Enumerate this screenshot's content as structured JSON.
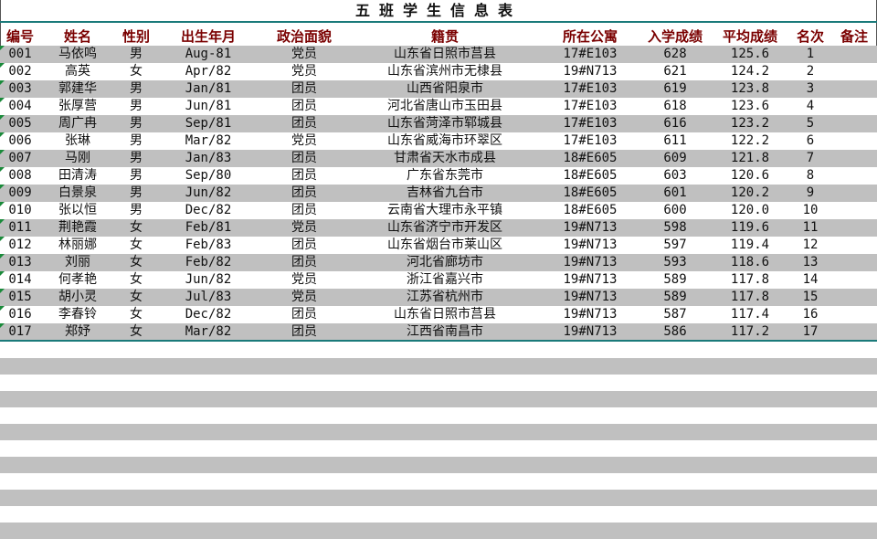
{
  "title": "五班学生信息表",
  "headers": [
    "编号",
    "姓名",
    "性别",
    "出生年月",
    "政治面貌",
    "籍贯",
    "所在公寓",
    "入学成绩",
    "平均成绩",
    "名次",
    "备注"
  ],
  "rows": [
    {
      "id": "001",
      "name": "马依鸣",
      "gender": "男",
      "birth": "Aug-81",
      "political": "党员",
      "native": "山东省日照市莒县",
      "dorm": "17#E103",
      "entry": "628",
      "avg": "125.6",
      "rank": "1",
      "note": ""
    },
    {
      "id": "002",
      "name": "高英",
      "gender": "女",
      "birth": "Apr/82",
      "political": "党员",
      "native": "山东省滨州市无棣县",
      "dorm": "19#N713",
      "entry": "621",
      "avg": "124.2",
      "rank": "2",
      "note": ""
    },
    {
      "id": "003",
      "name": "郭建华",
      "gender": "男",
      "birth": "Jan/81",
      "political": "团员",
      "native": "山西省阳泉市",
      "dorm": "17#E103",
      "entry": "619",
      "avg": "123.8",
      "rank": "3",
      "note": ""
    },
    {
      "id": "004",
      "name": "张厚营",
      "gender": "男",
      "birth": "Jun/81",
      "political": "团员",
      "native": "河北省唐山市玉田县",
      "dorm": "17#E103",
      "entry": "618",
      "avg": "123.6",
      "rank": "4",
      "note": ""
    },
    {
      "id": "005",
      "name": "周广冉",
      "gender": "男",
      "birth": "Sep/81",
      "political": "团员",
      "native": "山东省菏泽市郓城县",
      "dorm": "17#E103",
      "entry": "616",
      "avg": "123.2",
      "rank": "5",
      "note": ""
    },
    {
      "id": "006",
      "name": "张琳",
      "gender": "男",
      "birth": "Mar/82",
      "political": "党员",
      "native": "山东省威海市环翠区",
      "dorm": "17#E103",
      "entry": "611",
      "avg": "122.2",
      "rank": "6",
      "note": ""
    },
    {
      "id": "007",
      "name": "马刚",
      "gender": "男",
      "birth": "Jan/83",
      "political": "团员",
      "native": "甘肃省天水市成县",
      "dorm": "18#E605",
      "entry": "609",
      "avg": "121.8",
      "rank": "7",
      "note": ""
    },
    {
      "id": "008",
      "name": "田清涛",
      "gender": "男",
      "birth": "Sep/80",
      "political": "团员",
      "native": "广东省东莞市",
      "dorm": "18#E605",
      "entry": "603",
      "avg": "120.6",
      "rank": "8",
      "note": ""
    },
    {
      "id": "009",
      "name": "白景泉",
      "gender": "男",
      "birth": "Jun/82",
      "political": "团员",
      "native": "吉林省九台市",
      "dorm": "18#E605",
      "entry": "601",
      "avg": "120.2",
      "rank": "9",
      "note": ""
    },
    {
      "id": "010",
      "name": "张以恒",
      "gender": "男",
      "birth": "Dec/82",
      "political": "团员",
      "native": "云南省大理市永平镇",
      "dorm": "18#E605",
      "entry": "600",
      "avg": "120.0",
      "rank": "10",
      "note": ""
    },
    {
      "id": "011",
      "name": "荆艳霞",
      "gender": "女",
      "birth": "Feb/81",
      "political": "党员",
      "native": "山东省济宁市开发区",
      "dorm": "19#N713",
      "entry": "598",
      "avg": "119.6",
      "rank": "11",
      "note": ""
    },
    {
      "id": "012",
      "name": "林丽娜",
      "gender": "女",
      "birth": "Feb/83",
      "political": "团员",
      "native": "山东省烟台市莱山区",
      "dorm": "19#N713",
      "entry": "597",
      "avg": "119.4",
      "rank": "12",
      "note": ""
    },
    {
      "id": "013",
      "name": "刘丽",
      "gender": "女",
      "birth": "Feb/82",
      "political": "团员",
      "native": "河北省廊坊市",
      "dorm": "19#N713",
      "entry": "593",
      "avg": "118.6",
      "rank": "13",
      "note": ""
    },
    {
      "id": "014",
      "name": "何孝艳",
      "gender": "女",
      "birth": "Jun/82",
      "political": "党员",
      "native": "浙江省嘉兴市",
      "dorm": "19#N713",
      "entry": "589",
      "avg": "117.8",
      "rank": "14",
      "note": ""
    },
    {
      "id": "015",
      "name": "胡小灵",
      "gender": "女",
      "birth": "Jul/83",
      "political": "党员",
      "native": "江苏省杭州市",
      "dorm": "19#N713",
      "entry": "589",
      "avg": "117.8",
      "rank": "15",
      "note": ""
    },
    {
      "id": "016",
      "name": "李春铃",
      "gender": "女",
      "birth": "Dec/82",
      "political": "团员",
      "native": "山东省日照市莒县",
      "dorm": "19#N713",
      "entry": "587",
      "avg": "117.4",
      "rank": "16",
      "note": ""
    },
    {
      "id": "017",
      "name": "郑妤",
      "gender": "女",
      "birth": "Mar/82",
      "political": "团员",
      "native": "江西省南昌市",
      "dorm": "19#N713",
      "entry": "586",
      "avg": "117.2",
      "rank": "17",
      "note": ""
    }
  ],
  "colors": {
    "header_text": "#7a0000",
    "band": "#c0c0c0",
    "accent_line": "#1a7a7a",
    "cell_marker": "#1a8a3a"
  }
}
